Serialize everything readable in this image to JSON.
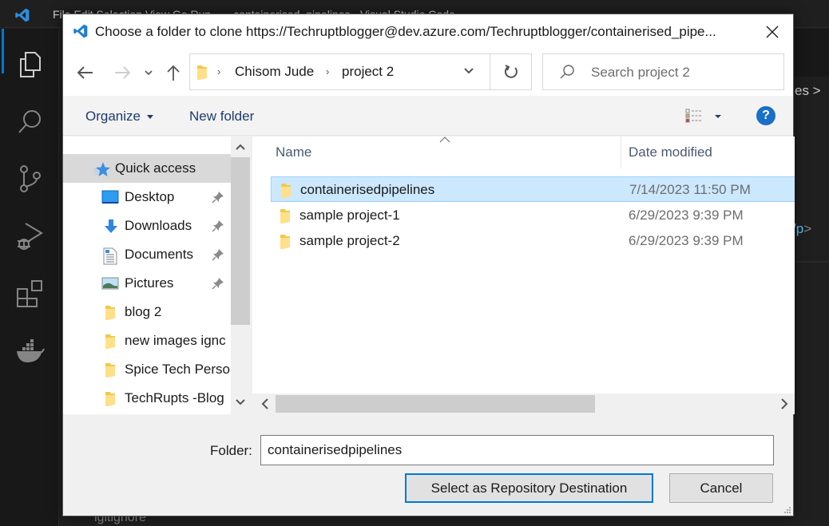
{
  "vscode": {
    "menu_ghost": "File  Edit  Selection  View  Go  Run  ...  - containerised_pipelines - Visual Studio Code",
    "right_fragment_1": "es >",
    "right_fragment_2": "/p",
    "right_fragment_2_tail": ">",
    "bottom_fragment": "igitignore",
    "activity_icons": [
      "explorer-icon",
      "search-icon",
      "source-control-icon",
      "run-debug-icon",
      "extensions-icon",
      "docker-icon"
    ]
  },
  "dialog": {
    "title": "Choose a folder to clone https://Techruptblogger@dev.azure.com/Techruptblogger/containerised_pipe...",
    "close_glyph": "✕",
    "address": {
      "crumbs": [
        "Chisom Jude",
        "project 2"
      ],
      "separator": "›"
    },
    "search": {
      "placeholder": "Search project 2"
    },
    "toolbar": {
      "organize": "Organize",
      "new_folder": "New folder",
      "help": "?"
    },
    "nav_pane": {
      "items": [
        {
          "label": "Quick access",
          "icon": "star-icon",
          "pinned": false,
          "selected": true
        },
        {
          "label": "Desktop",
          "icon": "desktop-icon",
          "pinned": true
        },
        {
          "label": "Downloads",
          "icon": "download-icon",
          "pinned": true
        },
        {
          "label": "Documents",
          "icon": "document-icon",
          "pinned": true
        },
        {
          "label": "Pictures",
          "icon": "pictures-icon",
          "pinned": true
        },
        {
          "label": "blog 2",
          "icon": "folder-icon",
          "pinned": false
        },
        {
          "label": "new images ignc",
          "icon": "folder-icon",
          "pinned": false
        },
        {
          "label": "Spice Tech Persor",
          "icon": "folder-icon",
          "pinned": false
        },
        {
          "label": "TechRupts -Blog",
          "icon": "folder-icon",
          "pinned": false
        }
      ]
    },
    "file_list": {
      "columns": [
        "Name",
        "Date modified"
      ],
      "rows": [
        {
          "name": "containerisedpipelines",
          "date": "7/14/2023 11:50 PM",
          "selected": true
        },
        {
          "name": "sample project-1",
          "date": "6/29/2023 9:39 PM",
          "selected": false
        },
        {
          "name": "sample project-2",
          "date": "6/29/2023 9:39 PM",
          "selected": false
        }
      ]
    },
    "footer": {
      "folder_label": "Folder:",
      "folder_value": "containerisedpipelines",
      "primary_button": "Select as Repository Destination",
      "cancel_button": "Cancel"
    }
  }
}
